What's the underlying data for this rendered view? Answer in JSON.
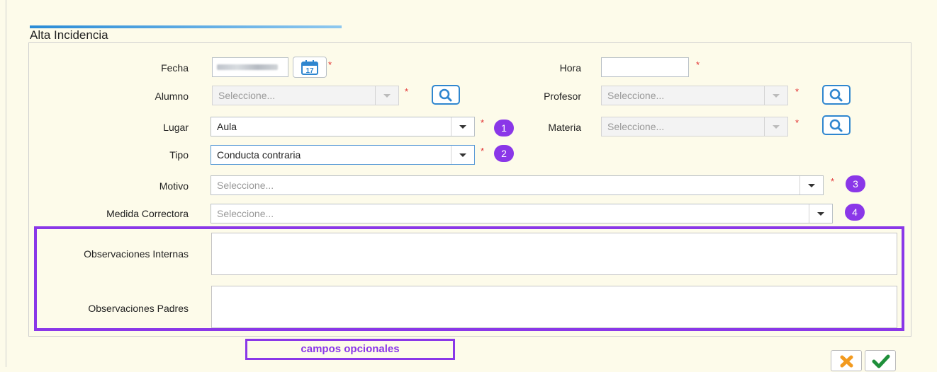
{
  "title": "Alta Incidencia",
  "labels": {
    "fecha": "Fecha",
    "hora": "Hora",
    "alumno": "Alumno",
    "profesor": "Profesor",
    "lugar": "Lugar",
    "materia": "Materia",
    "tipo": "Tipo",
    "motivo": "Motivo",
    "medida": "Medida Correctora",
    "obs_internas": "Observaciones Internas",
    "obs_padres": "Observaciones Padres"
  },
  "fields": {
    "alumno_placeholder": "Seleccione...",
    "profesor_placeholder": "Seleccione...",
    "lugar_value": "Aula",
    "materia_placeholder": "Seleccione...",
    "tipo_value": "Conducta contraria",
    "motivo_placeholder": "Seleccione...",
    "medida_placeholder": "Seleccione...",
    "calendar_day": "17"
  },
  "required_mark": "*",
  "badges": [
    "1",
    "2",
    "3",
    "4"
  ],
  "optional_label": "campos opcionales",
  "colors": {
    "accent_purple": "#8a37e8",
    "button_blue": "#2f86cf",
    "cancel_orange": "#f29a1f",
    "confirm_green": "#1e8f3a",
    "required_red": "#e23030"
  }
}
